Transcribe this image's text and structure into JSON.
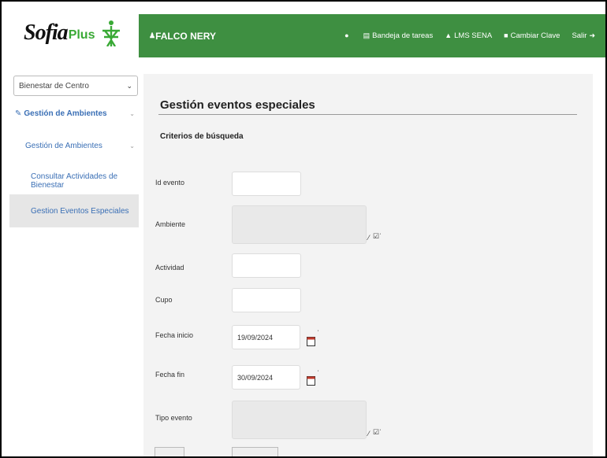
{
  "logo": {
    "text_main": "Sofia",
    "text_plus": "Plus"
  },
  "topbar": {
    "user": "FALCO NERY",
    "nav": [
      {
        "label": "",
        "icon": "location-icon"
      },
      {
        "label": "Bandeja de tareas",
        "icon": "inbox-icon"
      },
      {
        "label": "LMS SENA",
        "icon": "graduation-icon"
      },
      {
        "label": "Cambiar Clave",
        "icon": "lock-icon"
      },
      {
        "label": "Salir",
        "icon": "logout-icon"
      }
    ]
  },
  "sidebar": {
    "select_value": "Bienestar de Centro",
    "items": [
      {
        "label": "Gestión de Ambientes"
      },
      {
        "label": "Gestión de Ambientes"
      },
      {
        "label": "Consultar Actividades de Bienestar"
      },
      {
        "label": "Gestion Eventos Especiales"
      }
    ]
  },
  "main": {
    "title": "Gestión eventos especiales",
    "subtitle": "Criterios de búsqueda",
    "fields": {
      "id_evento": {
        "label": "Id evento",
        "value": ""
      },
      "ambiente": {
        "label": "Ambiente",
        "value": ""
      },
      "actividad": {
        "label": "Actividad",
        "value": ""
      },
      "cupo": {
        "label": "Cupo",
        "value": ""
      },
      "fecha_inicio": {
        "label": "Fecha inicio",
        "value": "19/09/2024"
      },
      "fecha_fin": {
        "label": "Fecha fin",
        "value": "30/09/2024"
      },
      "tipo_evento": {
        "label": "Tipo evento",
        "value": ""
      }
    }
  },
  "colors": {
    "topbar": "#3e8f41",
    "link": "#3a6fb5",
    "logo_green": "#39a935"
  }
}
